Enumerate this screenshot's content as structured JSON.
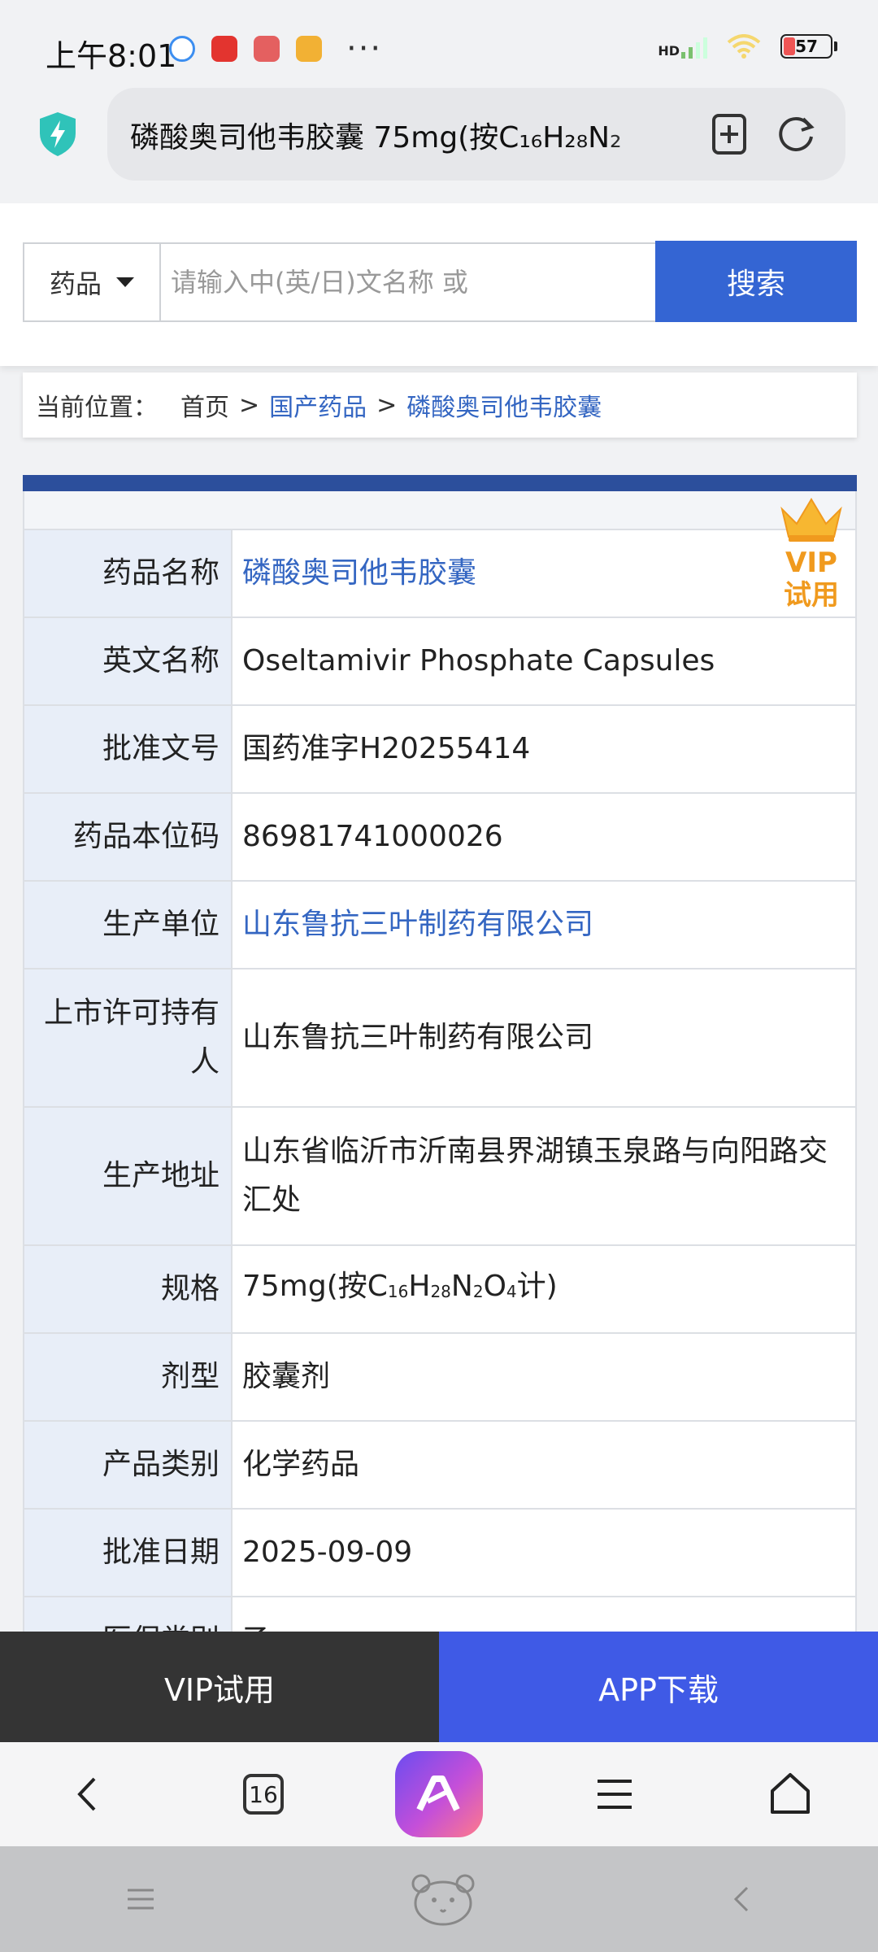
{
  "status_bar": {
    "time": "上午8:01",
    "network_label": "HD",
    "battery_level": "57"
  },
  "browser": {
    "url_text": "磷酸奥司他韦胶囊 75mg(按C₁₆H₂₈N₂",
    "tabs_count": "16"
  },
  "search": {
    "category": "药品",
    "placeholder": "请输入中(英/日)文名称 或",
    "button_label": "搜索"
  },
  "breadcrumb": {
    "label": "当前位置：",
    "home": "首页",
    "sep": ">",
    "section": "国产药品",
    "current": "磷酸奥司他韦胶囊"
  },
  "vip_badge": {
    "line1": "VIP",
    "line2": "试用"
  },
  "drug": {
    "rows": [
      {
        "label": "药品名称",
        "value": "磷酸奥司他韦胶囊"
      },
      {
        "label": "英文名称",
        "value": "Oseltamivir Phosphate Capsules"
      },
      {
        "label": "批准文号",
        "value": "国药准字H20255414"
      },
      {
        "label": "药品本位码",
        "value": "86981741000026"
      },
      {
        "label": "生产单位",
        "value": "山东鲁抗三叶制药有限公司"
      },
      {
        "label": "上市许可持有人",
        "value": "山东鲁抗三叶制药有限公司"
      },
      {
        "label": "生产地址",
        "value": "山东省临沂市沂南县界湖镇玉泉路与向阳路交汇处"
      },
      {
        "label": "规格",
        "value_prefix": "75mg(按C",
        "sub1": "16",
        "mid1": "H",
        "sub2": "28",
        "mid2": "N",
        "sub3": "2",
        "mid3": "O",
        "sub4": "4",
        "value_suffix": "计)"
      },
      {
        "label": "剂型",
        "value": "胶囊剂"
      },
      {
        "label": "产品类别",
        "value": "化学药品"
      },
      {
        "label": "批准日期",
        "value": "2025-09-09"
      },
      {
        "label": "医保类别",
        "value": "乙"
      }
    ]
  },
  "bottom_banner": {
    "vip_label": "VIP试用",
    "app_label": "APP下载"
  },
  "colors": {
    "primary_blue": "#3465d3",
    "link_blue": "#3466c2",
    "vip_orange": "#f09a1e"
  }
}
